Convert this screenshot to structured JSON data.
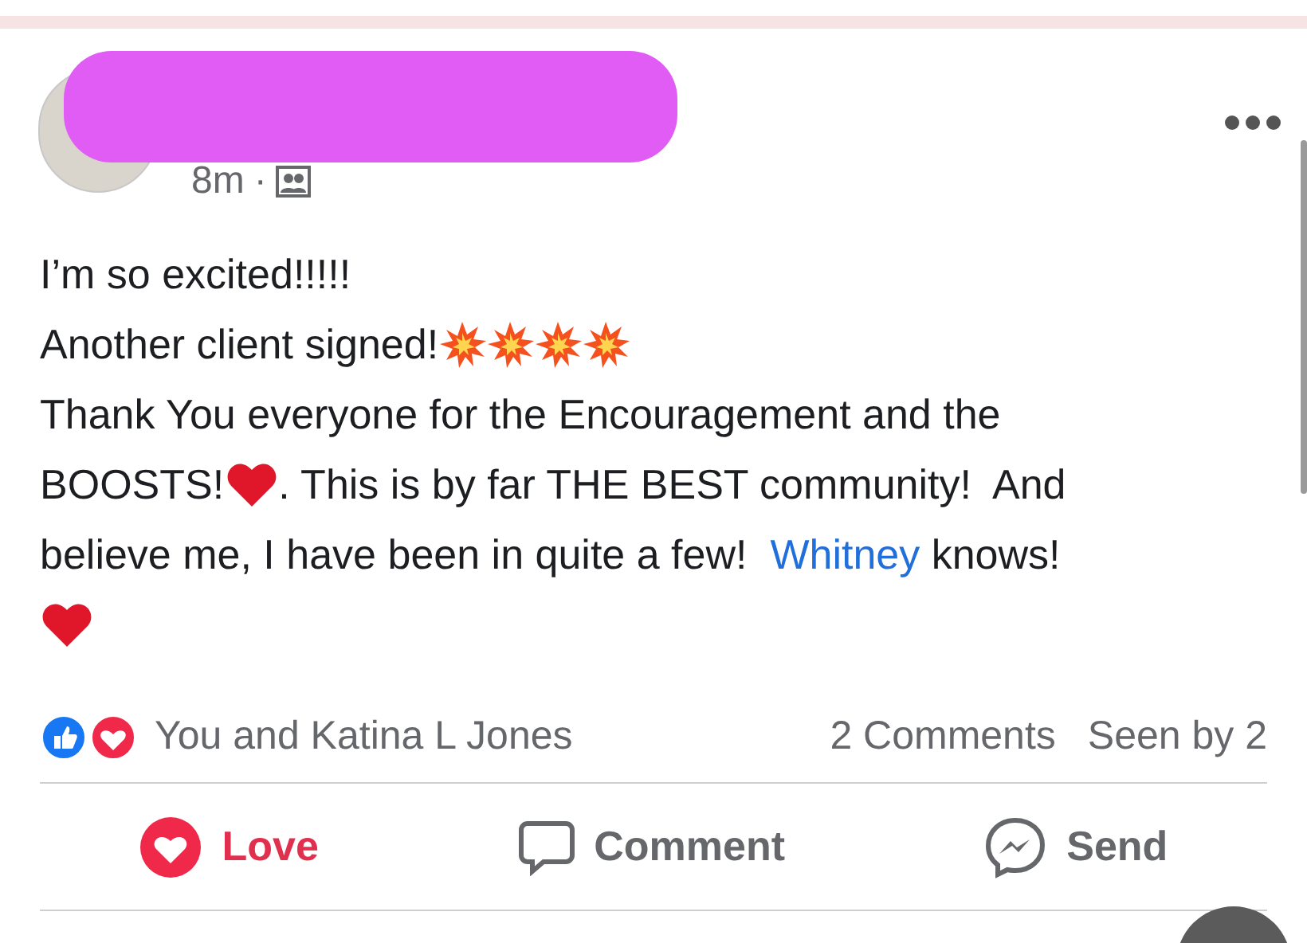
{
  "post": {
    "time": "8m",
    "separator": "·",
    "body": [
      [
        {
          "kind": "text",
          "text": "I’m so excited!!!!!"
        }
      ],
      [
        {
          "kind": "text",
          "text": "Another client signed!"
        },
        {
          "kind": "burst"
        },
        {
          "kind": "burst"
        },
        {
          "kind": "burst"
        },
        {
          "kind": "burst"
        }
      ],
      [
        {
          "kind": "text",
          "text": "Thank You everyone for the Encouragement and the"
        }
      ],
      [
        {
          "kind": "text",
          "text": "BOOSTS!"
        },
        {
          "kind": "heart"
        },
        {
          "kind": "text",
          "text": ". This is by far THE BEST community!  And"
        }
      ],
      [
        {
          "kind": "text",
          "text": "believe me, I have been in quite a few!  "
        },
        {
          "kind": "link",
          "text": "Whitney"
        },
        {
          "kind": "text",
          "text": " knows!"
        }
      ],
      [
        {
          "kind": "heart"
        }
      ]
    ],
    "reactions_text": "You and Katina L Jones",
    "comments": "2 Comments",
    "seen": "Seen by 2",
    "actions": [
      {
        "kind": "love",
        "label": "Love",
        "selected": true
      },
      {
        "kind": "comment",
        "label": "Comment",
        "selected": false
      },
      {
        "kind": "send",
        "label": "Send",
        "selected": false
      }
    ]
  }
}
